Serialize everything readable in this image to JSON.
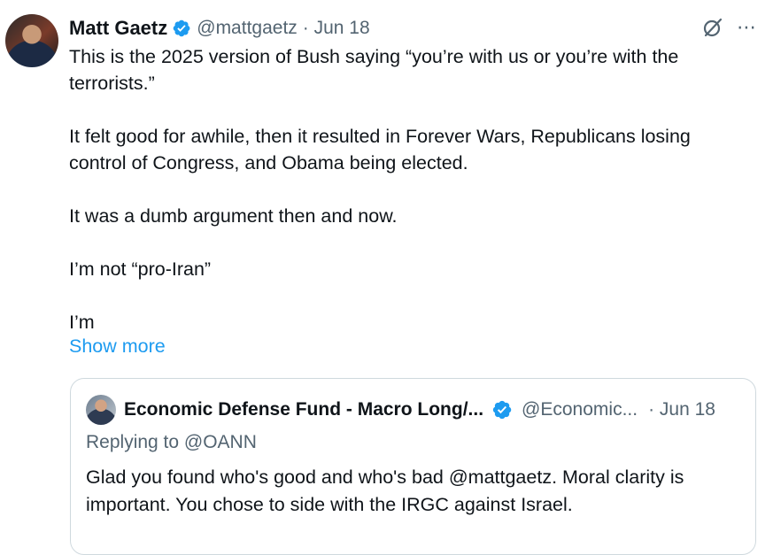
{
  "tweet": {
    "author_name": "Matt Gaetz",
    "author_handle": "@mattgaetz",
    "date": "· Jun 18",
    "paragraphs": [
      "This is the 2025 version of Bush saying “you’re with us or you’re with the terrorists.”",
      "It felt good for awhile, then it resulted in Forever Wars, Republicans losing control of Congress, and Obama being elected.",
      "It was a dumb argument then and now.",
      "I’m not “pro-Iran”",
      "I’m"
    ],
    "show_more_label": "Show more",
    "more_icon": "⋯"
  },
  "quoted_tweet": {
    "author_name": "Economic Defense Fund - Macro Long/...",
    "author_handle": "@Economic...",
    "date": "· Jun 18",
    "replying_to": "Replying to @OANN",
    "text": "Glad you found who's good and who's bad @mattgaetz. Moral clarity is important. You chose to side with the IRGC against Israel."
  },
  "colors": {
    "verified": "#1d9bf0",
    "link": "#1d9bf0",
    "secondary_text": "#536471",
    "border": "#cfd9de"
  }
}
